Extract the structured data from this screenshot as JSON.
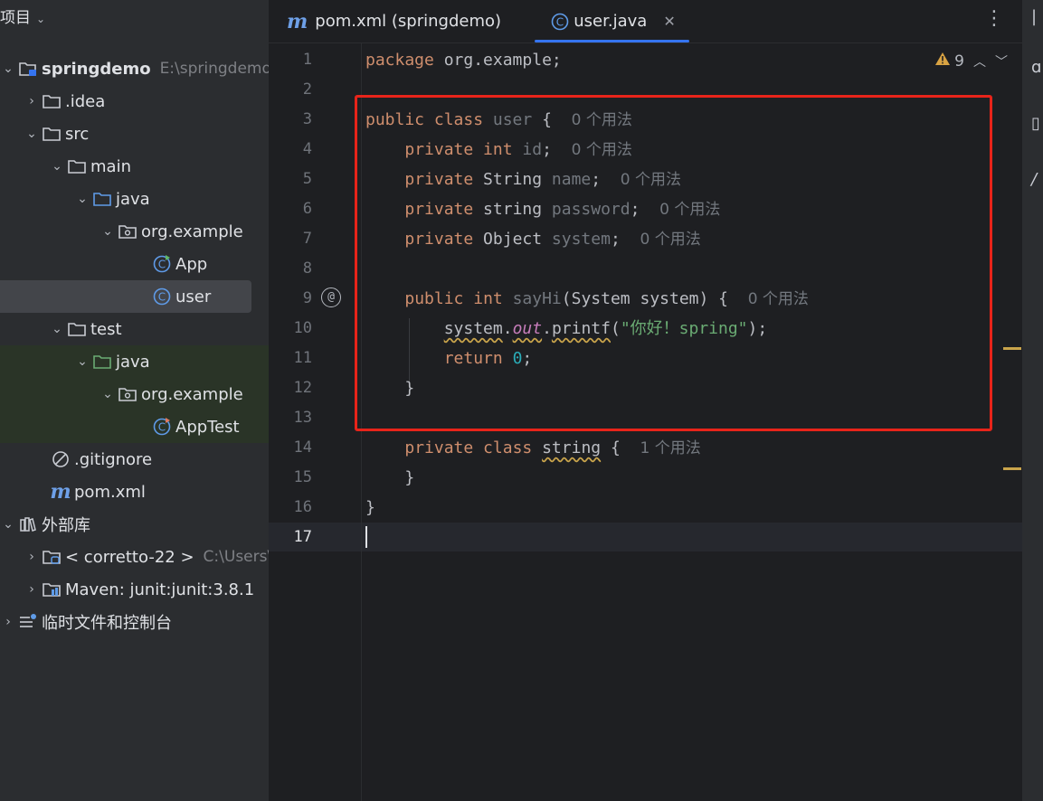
{
  "project_panel": {
    "title": "项目",
    "tree": [
      {
        "label": "springdemo",
        "path": "E:\\springdemo",
        "kind": "module"
      },
      {
        "label": ".idea",
        "kind": "folder"
      },
      {
        "label": "src",
        "kind": "folder"
      },
      {
        "label": "main",
        "kind": "folder"
      },
      {
        "label": "java",
        "kind": "source-folder"
      },
      {
        "label": "org.example",
        "kind": "package"
      },
      {
        "label": "App",
        "kind": "class-main"
      },
      {
        "label": "user",
        "kind": "class"
      },
      {
        "label": "test",
        "kind": "folder"
      },
      {
        "label": "java",
        "kind": "test-folder"
      },
      {
        "label": "org.example",
        "kind": "package"
      },
      {
        "label": "AppTest",
        "kind": "class-test"
      },
      {
        "label": ".gitignore",
        "kind": "ignore-file"
      },
      {
        "label": "pom.xml",
        "kind": "maven-file",
        "icon_text": "m"
      },
      {
        "label": "外部库",
        "kind": "library"
      },
      {
        "label": "< corretto-22 >",
        "path": "C:\\Users\\",
        "kind": "jdk"
      },
      {
        "label": "Maven: junit:junit:3.8.1",
        "kind": "maven-lib"
      },
      {
        "label": "临时文件和控制台",
        "kind": "scratches"
      }
    ]
  },
  "tabs": [
    {
      "label": "pom.xml (springdemo)",
      "icon_text": "m",
      "active": false
    },
    {
      "label": "user.java",
      "icon_text": "C",
      "active": true
    }
  ],
  "editor": {
    "warning_count": "9",
    "line_numbers": [
      "1",
      "2",
      "3",
      "4",
      "5",
      "6",
      "7",
      "8",
      "9",
      "10",
      "11",
      "12",
      "13",
      "14",
      "15",
      "16",
      "17"
    ],
    "usage_0": "0 个用法",
    "usage_1": "1 个用法",
    "code": {
      "l1_kw": "package",
      "l1_rest": " org.example;",
      "l3_kw": "public class",
      "l3_name": " user",
      "l4_kw": "private",
      "l4_type": " int",
      "l4_field": " id",
      "l5_kw": "private",
      "l5_type": " String",
      "l5_field": " name",
      "l6_kw": "private",
      "l6_type": " string",
      "l6_field": " password",
      "l7_kw": "private",
      "l7_type": " Object",
      "l7_field": " system",
      "l9_kw": "public",
      "l9_type": " int",
      "l9_name": " sayHi",
      "l9_params": "(System system) {",
      "l10_obj": "system",
      "l10_out": "out",
      "l10_method": "printf",
      "l10_str": "\"你好！spring\"",
      "l11_kw": "return",
      "l11_num": "0",
      "l14_kw": "private class",
      "l14_name": "string",
      "brace_open": " {",
      "brace_close": "}",
      "semicolon": ";"
    }
  },
  "colors": {
    "accent": "#3574f0",
    "highlight_box": "#e8241a",
    "keyword": "#cf8e6d",
    "string": "#6aab73",
    "number": "#2aacb8"
  }
}
